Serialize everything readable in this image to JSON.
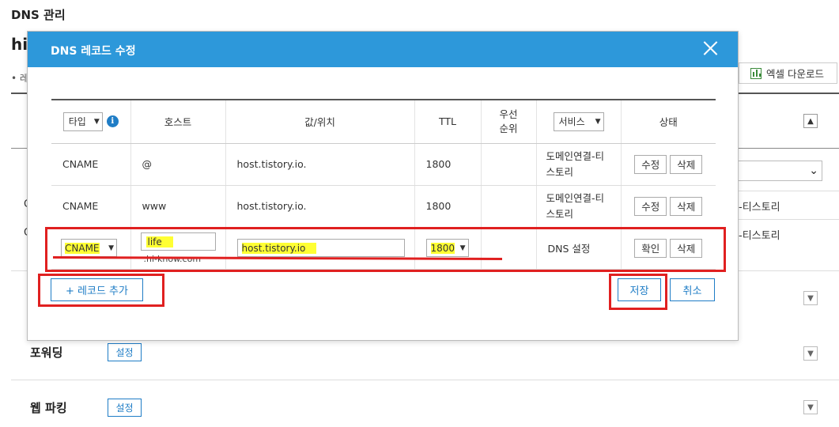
{
  "page": {
    "title": "DNS 관리",
    "domain_partial": "hi",
    "bullet_partial": "• 레",
    "excel_button": "엑셀 다운로드",
    "bg_rows": [
      {
        "type": "C",
        "service": "-티스토리"
      },
      {
        "type": "C",
        "service": "-티스토리"
      }
    ],
    "sections": [
      {
        "label": "포워딩",
        "button": "설정"
      },
      {
        "label": "웹 파킹",
        "button": "설정"
      }
    ],
    "icons": {
      "excel": "excel-icon",
      "chevron_up": "chevron-up-icon",
      "chevron_down": "chevron-down-icon"
    }
  },
  "modal": {
    "title": "DNS 레코드 수정",
    "close_icon": "close-icon",
    "headers": {
      "type_select": "타입",
      "host": "호스트",
      "value": "값/위치",
      "ttl": "TTL",
      "priority": "우선\n순위",
      "service_select": "서비스",
      "status": "상태"
    },
    "rows": [
      {
        "type": "CNAME",
        "host": "@",
        "value": "host.tistory.io.",
        "ttl": "1800",
        "priority": "",
        "service": "도메인연결-티\n스토리",
        "actions": [
          "수정",
          "삭제"
        ]
      },
      {
        "type": "CNAME",
        "host": "www",
        "value": "host.tistory.io.",
        "ttl": "1800",
        "priority": "",
        "service": "도메인연결-티\n스토리",
        "actions": [
          "수정",
          "삭제"
        ]
      }
    ],
    "edit_row": {
      "type": "CNAME",
      "host_input": "life",
      "host_suffix": ".hi-know.com",
      "value_input": "host.tistory.io",
      "ttl": "1800",
      "service": "DNS 설정",
      "actions": [
        "확인",
        "삭제"
      ]
    },
    "add_button": "+ 레코드 추가",
    "save_button": "저장",
    "cancel_button": "취소"
  },
  "colors": {
    "header_blue": "#2d98da",
    "accent_blue": "#1f7dc6",
    "annotation_red": "#e02020",
    "highlight_yellow": "#ffff33"
  }
}
